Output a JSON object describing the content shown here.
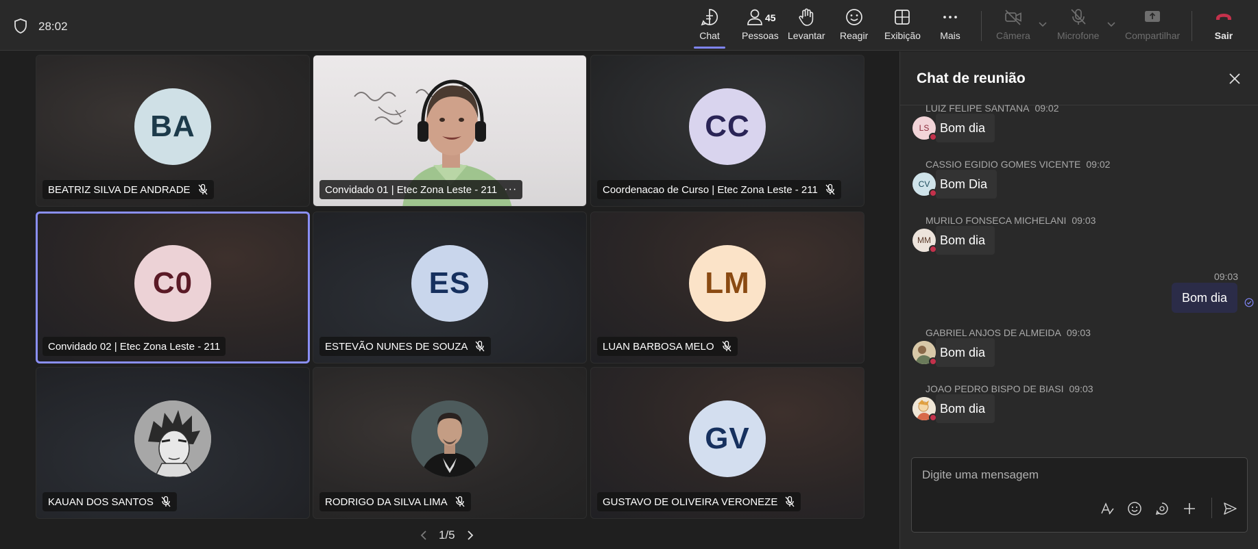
{
  "header": {
    "timer": "28:02",
    "people_count": "45",
    "buttons": {
      "chat": "Chat",
      "people": "Pessoas",
      "raise": "Levantar",
      "react": "Reagir",
      "view": "Exibição",
      "more": "Mais",
      "camera": "Câmera",
      "mic": "Microfone",
      "share": "Compartilhar",
      "leave": "Sair"
    }
  },
  "tiles": [
    {
      "name": "BEATRIZ SILVA DE ANDRADE",
      "initials": "BA"
    },
    {
      "name": "Convidado 01 | Etec Zona Leste - 211",
      "more": "···"
    },
    {
      "name": "Coordenacao de Curso | Etec Zona Leste - 211",
      "initials": "CC"
    },
    {
      "name": "Convidado 02 | Etec Zona Leste - 211",
      "initials": "C0"
    },
    {
      "name": "ESTEVÃO NUNES DE SOUZA",
      "initials": "ES"
    },
    {
      "name": "LUAN BARBOSA MELO",
      "initials": "LM"
    },
    {
      "name": "KAUAN DOS SANTOS"
    },
    {
      "name": "RODRIGO DA SILVA LIMA"
    },
    {
      "name": "GUSTAVO DE OLIVEIRA VERONEZE",
      "initials": "GV"
    }
  ],
  "pager": {
    "label": "1/5"
  },
  "chat": {
    "title": "Chat de reunião",
    "messages": [
      {
        "sender": "LUIZ FELIPE SANTANA",
        "time": "09:02",
        "initials": "LS",
        "text": "Bom dia"
      },
      {
        "sender": "CASSIO EGIDIO GOMES VICENTE",
        "time": "09:02",
        "initials": "CV",
        "text": "Bom Dia"
      },
      {
        "sender": "MURILO FONSECA MICHELANI",
        "time": "09:03",
        "initials": "MM",
        "text": "Bom dia"
      },
      {
        "sender": "GABRIEL ANJOS DE ALMEIDA",
        "time": "09:03",
        "initials": "",
        "text": "Bom dia"
      },
      {
        "sender": "JOAO PEDRO BISPO DE BIASI",
        "time": "09:03",
        "initials": "",
        "text": "Bom dia"
      }
    ],
    "my_message": {
      "time": "09:03",
      "text": "Bom dia"
    },
    "composer_placeholder": "Digite uma mensagem"
  },
  "colors": {
    "accent": "#7f85f5",
    "leave": "#c4314b",
    "status_busy": "#c4314b"
  }
}
